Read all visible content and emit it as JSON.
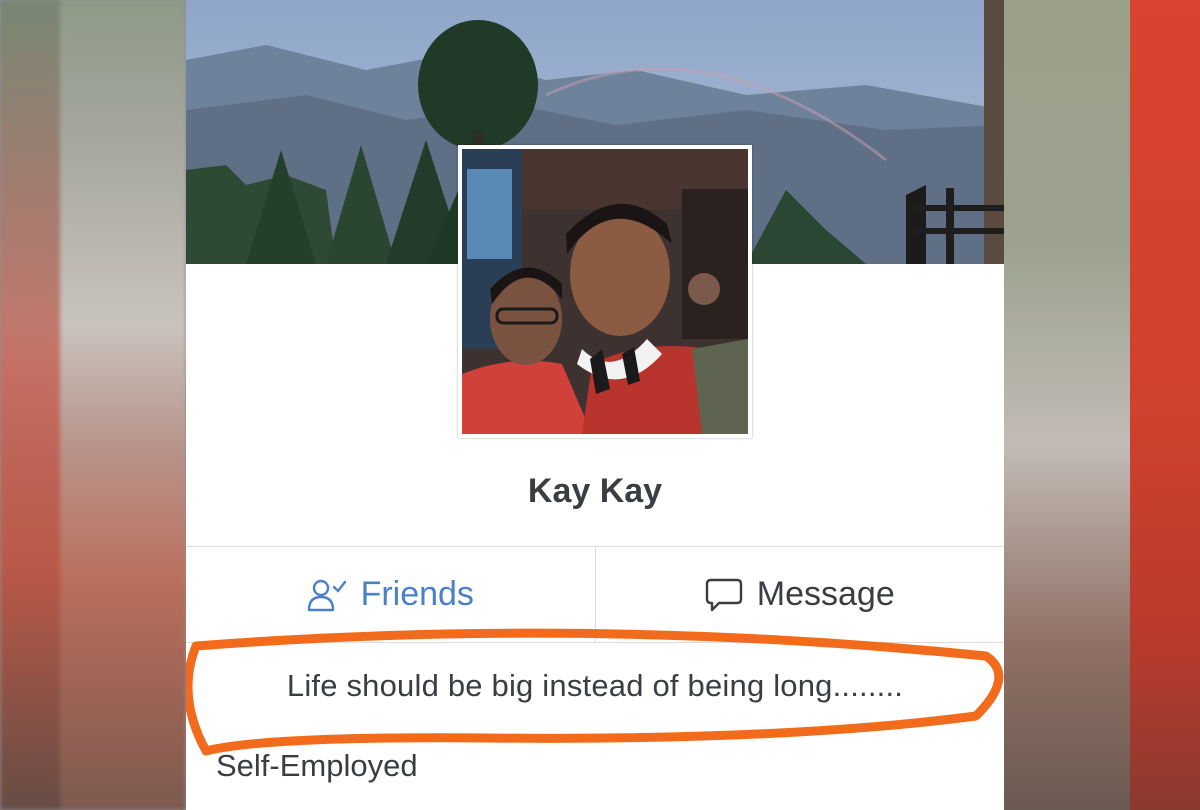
{
  "profile": {
    "name": "Kay Kay",
    "bio": "Life should be big instead of being long........",
    "work": "Self-Employed"
  },
  "actions": {
    "friends_label": "Friends",
    "message_label": "Message"
  },
  "icons": {
    "friends": "friends-check-icon",
    "message": "speech-bubble-icon"
  },
  "colors": {
    "friends_accent": "#4a80c8",
    "text": "#3b3d42",
    "highlight_annotation": "#f26b1d"
  }
}
